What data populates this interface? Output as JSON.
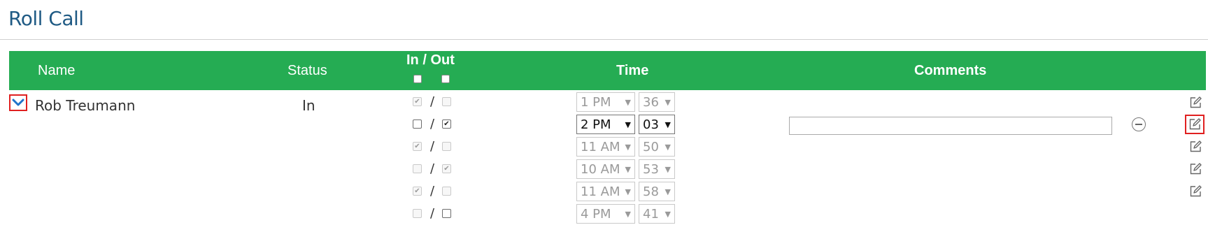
{
  "page": {
    "title": "Roll Call"
  },
  "table": {
    "headers": {
      "name": "Name",
      "status": "Status",
      "inout": "In / Out",
      "time": "Time",
      "comments": "Comments"
    },
    "row": {
      "name": "Rob Treumann",
      "status": "In",
      "entries": [
        {
          "in": true,
          "out": false,
          "hour": "1 PM",
          "minute": "36",
          "active": false
        },
        {
          "in": false,
          "out": true,
          "hour": "2 PM",
          "minute": "03",
          "active": true,
          "comment": ""
        },
        {
          "in": true,
          "out": false,
          "hour": "11 AM",
          "minute": "50",
          "active": false
        },
        {
          "in": false,
          "out": true,
          "hour": "10 AM",
          "minute": "53",
          "active": false
        },
        {
          "in": true,
          "out": false,
          "hour": "11 AM",
          "minute": "58",
          "active": false
        },
        {
          "in": false,
          "out": false,
          "hour": "4 PM",
          "minute": "41",
          "active": false
        }
      ]
    }
  },
  "icons": {
    "expand": "chevron-down-icon",
    "edit": "edit-icon",
    "remove": "minus-circle-icon",
    "dropdown": "caret-down-icon"
  },
  "colors": {
    "header_bg": "#25ac53",
    "title": "#1f5a84",
    "highlight": "#e02020"
  }
}
